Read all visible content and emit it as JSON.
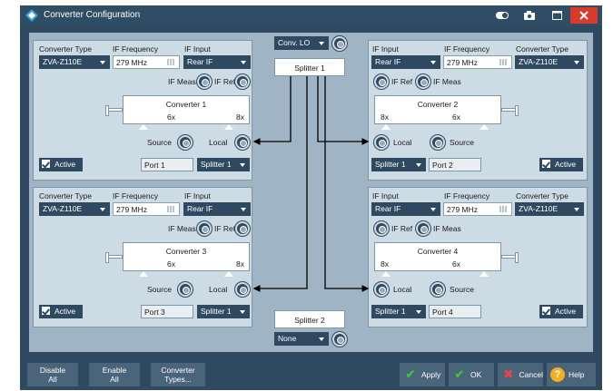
{
  "window": {
    "title": "Converter Configuration"
  },
  "colors": {
    "titlebar": "#304d66",
    "panel": "#cddbe5",
    "canvas": "#9fb4c4",
    "close": "#d93b2b",
    "apply_check": "#3fbf3f",
    "cancel_x": "#e04646",
    "help": "#f2b01e"
  },
  "labels": {
    "converter_type": "Converter Type",
    "if_frequency": "IF Frequency",
    "if_input": "IF Input",
    "if_meas": "IF Meas",
    "if_ref": "IF Ref",
    "source": "Source",
    "local": "Local",
    "active": "Active"
  },
  "center": {
    "conv_lo_value": "Conv. LO",
    "splitter1": "Splitter 1",
    "splitter2": "Splitter 2",
    "none_value": "None"
  },
  "converters": [
    {
      "title": "Converter 1",
      "type": "ZVA-Z110E",
      "freq": "279 MHz",
      "input": "Rear IF",
      "mult_left": "6x",
      "mult_right": "8x",
      "port": "Port 1",
      "splitter": "Splitter 1"
    },
    {
      "title": "Converter 2",
      "type": "ZVA-Z110E",
      "freq": "279 MHz",
      "input": "Rear IF",
      "mult_left": "8x",
      "mult_right": "6x",
      "port": "Port 2",
      "splitter": "Splitter 1"
    },
    {
      "title": "Converter 3",
      "type": "ZVA-Z110E",
      "freq": "279 MHz",
      "input": "Rear IF",
      "mult_left": "6x",
      "mult_right": "8x",
      "port": "Port 3",
      "splitter": "Splitter 1"
    },
    {
      "title": "Converter 4",
      "type": "ZVA-Z110E",
      "freq": "279 MHz",
      "input": "Rear IF",
      "mult_left": "8x",
      "mult_right": "6x",
      "port": "Port 4",
      "splitter": "Splitter 1"
    }
  ],
  "bottom": {
    "disable_all_1": "Disable",
    "disable_all_2": "All",
    "enable_all_1": "Enable",
    "enable_all_2": "All",
    "types_1": "Converter",
    "types_2": "Types...",
    "apply": "Apply",
    "ok": "OK",
    "cancel": "Cancel",
    "help": "Help"
  }
}
